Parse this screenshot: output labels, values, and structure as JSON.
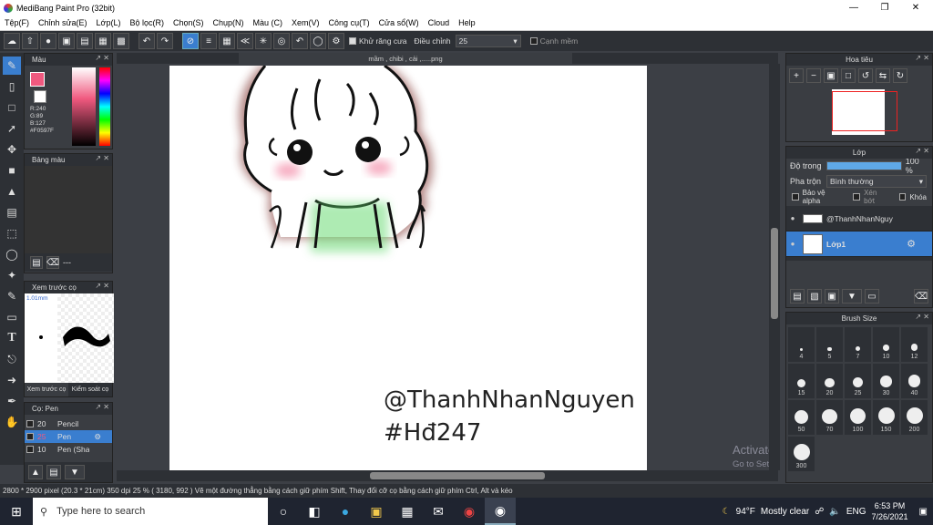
{
  "window": {
    "title": "MediBang Paint Pro (32bit)"
  },
  "menu": [
    "Tệp(F)",
    "Chỉnh sửa(E)",
    "Lớp(L)",
    "Bộ lọc(R)",
    "Chọn(S)",
    "Chụp(N)",
    "Màu (C)",
    "Xem(V)",
    "Công cụ(T)",
    "Cửa sổ(W)",
    "Cloud",
    "Help"
  ],
  "toolbar": {
    "antialias_label": "Khử răng cưa",
    "adjust_label": "Điều chỉnh",
    "adjust_value": "25",
    "edge_label": "Cạnh mềm"
  },
  "tab": {
    "filename": "mầm , chibi , cải ,.....png"
  },
  "color_panel": {
    "title": "Màu",
    "r": "R:240",
    "g": "G:89",
    "b": "B:127",
    "hex": "#F0597F",
    "color": "#f0597f"
  },
  "palette_panel": {
    "title": "Bảng màu",
    "dots": "---"
  },
  "preview_panel": {
    "title": "Xem trước cọ",
    "size": "1.01mm",
    "tab1": "Xem trước cọ",
    "tab2": "Kiểm soát cọ"
  },
  "brush_panel": {
    "title": "Cọ: Pen",
    "brushes": [
      {
        "size": "20",
        "name": "Pencil"
      },
      {
        "size": "25",
        "name": "Pen"
      },
      {
        "size": "10",
        "name": "Pen (Sha"
      }
    ]
  },
  "navigator": {
    "title": "Hoa tiêu"
  },
  "layer_panel": {
    "title": "Lớp",
    "opacity_label": "Độ trong",
    "opacity_value": "100 %",
    "opacity": 1.0,
    "blend_label": "Pha trộn",
    "blend_value": "Bình thường",
    "protect_alpha": "Bảo vệ alpha",
    "clipping": "Xén bớt",
    "lock": "Khóa",
    "layers": [
      {
        "name": "@ThanhNhanNguy"
      },
      {
        "name": "Lớp1"
      }
    ]
  },
  "brush_size": {
    "title": "Brush Size",
    "sizes": [
      "4",
      "5",
      "7",
      "10",
      "12",
      "15",
      "20",
      "25",
      "30",
      "40",
      "50",
      "70",
      "100",
      "150",
      "200",
      "300"
    ]
  },
  "canvas": {
    "watermark_line1": "@ThanhNhanNguyen",
    "watermark_line2": "#Hđ247"
  },
  "activate": {
    "line1": "Activate Windows",
    "line2": "Go to Settings to activate Windows."
  },
  "status": {
    "text": "2800 * 2900 pixel   (20.3 * 21cm)   350 dpi   25 %   ( 3180, 992 )   Vẽ một đường thẳng bằng cách giữ phím Shift, Thay đổi cỡ cọ bằng cách giữ phím Ctrl, Alt và kéo"
  },
  "taskbar": {
    "search_placeholder": "Type here to search",
    "weather_temp": "94°F",
    "weather_text": "Mostly clear",
    "lang": "ENG",
    "time": "6:53 PM",
    "date": "7/26/2021"
  }
}
